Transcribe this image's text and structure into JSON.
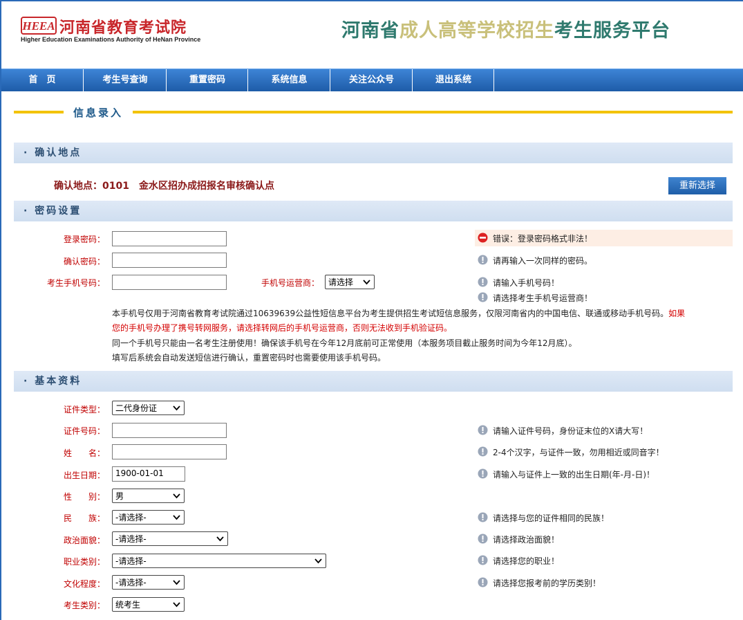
{
  "header": {
    "logo_mark": "HEEA",
    "logo_cn": "河南省教育考试院",
    "logo_en": "Higher Education Examinations Authority of HeNan Province",
    "title_part1": "河南省",
    "title_part2": "成人高等学校招生",
    "title_part3": "考生服务平台"
  },
  "nav": {
    "items": [
      "首　页",
      "考生号查询",
      "重置密码",
      "系统信息",
      "关注公众号",
      "退出系统"
    ]
  },
  "page_banner": "信息录入",
  "sections": {
    "confirm": "· 确认地点",
    "password": "· 密码设置",
    "basic": "· 基本资料"
  },
  "confirm": {
    "text": "确认地点：0101　金水区招办成招报名审核确认点",
    "reselect_label": "重新选择"
  },
  "password": {
    "login_label": "登录密码：",
    "confirm_label": "确认密码：",
    "phone_label": "考生手机号码：",
    "carrier_label": "手机号运营商：",
    "carrier_value": "请选择",
    "error": "错误：登录密码格式非法！",
    "hint_confirm": "请再输入一次同样的密码。",
    "hint_phone": "请输入手机号码！",
    "hint_carrier": "请选择考生手机号运营商！",
    "note1a": "本手机号仅用于河南省教育考试院通过10639639公益性短信息平台为考生提供招生考试短信息服务，仅限河南省内的中国电信、联通或移动手机号码。",
    "note1b": "如果",
    "note2": "您的手机号办理了携号转网服务，请选择转网后的手机号运营商，否则无法收到手机验证码。",
    "note3": "同一个手机号只能由一名考生注册使用！确保该手机号在今年12月底前可正常使用（本服务项目截止服务时间为今年12月底）。",
    "note4": "填写后系统会自动发送短信进行确认，重置密码时也需要使用该手机号码。"
  },
  "basic": {
    "id_type_label": "证件类型：",
    "id_type_value": "二代身份证",
    "id_no_label": "证件号码：",
    "name_label": "姓　　名：",
    "birth_label": "出生日期：",
    "birth_value": "1900-01-01",
    "gender_label": "性　　别：",
    "gender_value": "男",
    "ethnic_label": "民　　族：",
    "ethnic_value": "-请选择-",
    "politics_label": "政治面貌：",
    "politics_value": "-请选择-",
    "job_label": "职业类别：",
    "job_value": "-请选择-",
    "edu_label": "文化程度：",
    "edu_value": "-请选择-",
    "type_label": "考生类别：",
    "type_value": "统考生",
    "hint_id": "请输入证件号码，身份证末位的X请大写！",
    "hint_name": "2-4个汉字，与证件一致，勿用相近或同音字！",
    "hint_birth": "请输入与证件上一致的出生日期(年-月-日)！",
    "hint_ethnic": "请选择与您的证件相同的民族！",
    "hint_politics": "请选择政治面貌！",
    "hint_job": "请选择您的职业！",
    "hint_edu": "请选择您报考前的学历类别！"
  }
}
